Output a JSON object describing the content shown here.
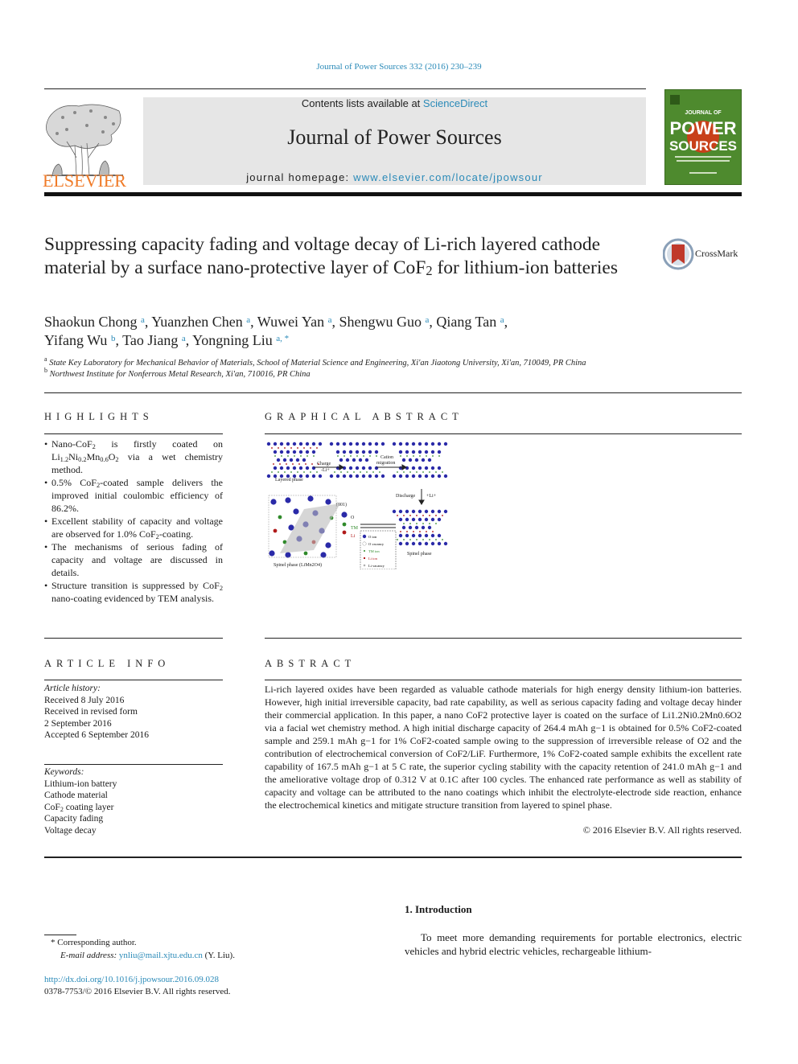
{
  "header": {
    "citation": "Journal of Power Sources 332 (2016) 230–239",
    "publisher_logo_text": "ELSEVIER",
    "contents_prefix": "Contents lists available at ",
    "contents_link": "ScienceDirect",
    "journal_title": "Journal of Power Sources",
    "homepage_prefix": "journal homepage: ",
    "homepage_link": "www.elsevier.com/locate/jpowsour",
    "cover": {
      "line1": "JOURNAL OF",
      "line2": "POWER",
      "line3": "SOURCES",
      "bg_color": "#4e8a2e",
      "accent_color": "#c8401a"
    },
    "colors": {
      "link": "#2a8ab8",
      "elsevier_orange": "#f07b28",
      "banner_bg": "#e6e6e6"
    }
  },
  "article": {
    "title_part1": "Suppressing capacity fading and voltage decay of Li-rich layered cathode material by a surface nano-protective layer of CoF",
    "title_sub": "2",
    "title_part2": " for lithium-ion batteries",
    "crossmark_label": "CrossMark",
    "authors": [
      {
        "name": "Shaokun Chong",
        "aff": "a",
        "sep": ", "
      },
      {
        "name": "Yuanzhen Chen",
        "aff": "a",
        "sep": ", "
      },
      {
        "name": "Wuwei Yan",
        "aff": "a",
        "sep": ", "
      },
      {
        "name": "Shengwu Guo",
        "aff": "a",
        "sep": ", "
      },
      {
        "name": "Qiang Tan",
        "aff": "a",
        "sep": ", "
      },
      {
        "name": "Yifang Wu",
        "aff": "b",
        "sep": ", "
      },
      {
        "name": "Tao Jiang",
        "aff": "a",
        "sep": ", "
      },
      {
        "name": "Yongning Liu",
        "aff": "a, *",
        "sep": ""
      }
    ],
    "affiliations": [
      {
        "mark": "a",
        "text": "State Key Laboratory for Mechanical Behavior of Materials, School of Material Science and Engineering, Xi'an Jiaotong University, Xi'an, 710049, PR China"
      },
      {
        "mark": "b",
        "text": "Northwest Institute for Nonferrous Metal Research, Xi'an, 710016, PR China"
      }
    ]
  },
  "highlights": {
    "heading": "HIGHLIGHTS",
    "items": [
      "Nano-CoF2 is firstly coated on Li1.2Ni0.2Mn0.6O2 via a wet chemistry method.",
      "0.5% CoF2-coated sample delivers the improved initial coulombic efficiency of 86.2%.",
      "Excellent stability of capacity and voltage are observed for 1.0% CoF2-coating.",
      "The mechanisms of serious fading of capacity and voltage are discussed in details.",
      "Structure transition is suppressed by CoF2 nano-coating evidenced by TEM analysis."
    ]
  },
  "graphical_abstract": {
    "heading": "GRAPHICAL ABSTRACT",
    "labels": {
      "layered_phase": "Layered phase",
      "charge": "Charge",
      "charge_sub": "-Li+",
      "cation_migration_1": "Cation",
      "cation_migration_2": "migration",
      "discharge": "Discharge",
      "discharge_sub": "+Li+",
      "spinel_phase": "Spinel phase",
      "spinel_formula": "Spinel phase (LiMn2O4)",
      "plane": "(001)",
      "legend_o": "O",
      "legend_tm": "TM",
      "legend_li": "Li"
    },
    "legend_box": [
      "O ion",
      "O vacancy",
      "TM ion",
      "Li ion",
      "Li vacancy"
    ],
    "colors": {
      "o": "#2a2aa8",
      "tm": "#2f8a2a",
      "li": "#b01a1a"
    }
  },
  "article_info": {
    "heading": "ARTICLE INFO",
    "history_label": "Article history:",
    "history": [
      "Received 8 July 2016",
      "Received in revised form",
      "2 September 2016",
      "Accepted 6 September 2016"
    ],
    "keywords_label": "Keywords:",
    "keywords": [
      "Lithium-ion battery",
      "Cathode material",
      "CoF2 coating layer",
      "Capacity fading",
      "Voltage decay"
    ]
  },
  "abstract": {
    "heading": "ABSTRACT",
    "text": "Li-rich layered oxides have been regarded as valuable cathode materials for high energy density lithium-ion batteries. However, high initial irreversible capacity, bad rate capability, as well as serious capacity fading and voltage decay hinder their commercial application. In this paper, a nano CoF2 protective layer is coated on the surface of Li1.2Ni0.2Mn0.6O2 via a facial wet chemistry method. A high initial discharge capacity of 264.4 mAh g−1 is obtained for 0.5% CoF2-coated sample and 259.1 mAh g−1 for 1% CoF2-coated sample owing to the suppression of irreversible release of O2 and the contribution of electrochemical conversion of CoF2/LiF. Furthermore, 1% CoF2-coated sample exhibits the excellent rate capability of 167.5 mAh g−1 at 5 C rate, the superior cycling stability with the capacity retention of 241.0 mAh g−1 and the ameliorative voltage drop of 0.312 V at 0.1C after 100 cycles. The enhanced rate performance as well as stability of capacity and voltage can be attributed to the nano coatings which inhibit the electrolyte-electrode side reaction, enhance the electrochemical kinetics and mitigate structure transition from layered to spinel phase.",
    "copyright": "© 2016 Elsevier B.V. All rights reserved."
  },
  "introduction": {
    "heading": "1.  Introduction",
    "text": "To meet more demanding requirements for portable electronics, electric vehicles and hybrid electric vehicles, rechargeable lithium-"
  },
  "footnotes": {
    "corresponding": "* Corresponding author.",
    "email_label": "E-mail address: ",
    "email": "ynliu@mail.xjtu.edu.cn",
    "email_suffix": " (Y. Liu).",
    "doi": "http://dx.doi.org/10.1016/j.jpowsour.2016.09.028",
    "issn": "0378-7753/© 2016 Elsevier B.V. All rights reserved."
  }
}
